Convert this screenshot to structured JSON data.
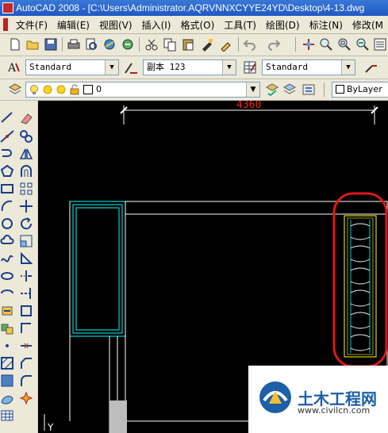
{
  "window": {
    "title": "AutoCAD 2008 - [C:\\Users\\Administrator.AQRVNNXCYYE24YD\\Desktop\\4-13.dwg"
  },
  "menu": [
    "文件(F)",
    "编辑(E)",
    "视图(V)",
    "插入(I)",
    "格式(O)",
    "工具(T)",
    "绘图(D)",
    "标注(N)",
    "修改(M"
  ],
  "styles_toolbar": {
    "text_style": "Standard",
    "dim_style": "副本 123",
    "table_style": "Standard"
  },
  "layers_toolbar": {
    "layer": "0",
    "color": "ByLayer"
  },
  "drawing": {
    "dimension_text": "4360",
    "ucs_label": "Y"
  },
  "watermark": {
    "title": "土木工程网",
    "url": "www.civilcn.com"
  },
  "colors": {
    "canvas": "#000000",
    "cad_white": "#ffffff",
    "cad_cyan": "#00ffff",
    "cad_yellow": "#ffff00",
    "dimension": "#ff2020",
    "highlight": "#e01818"
  }
}
